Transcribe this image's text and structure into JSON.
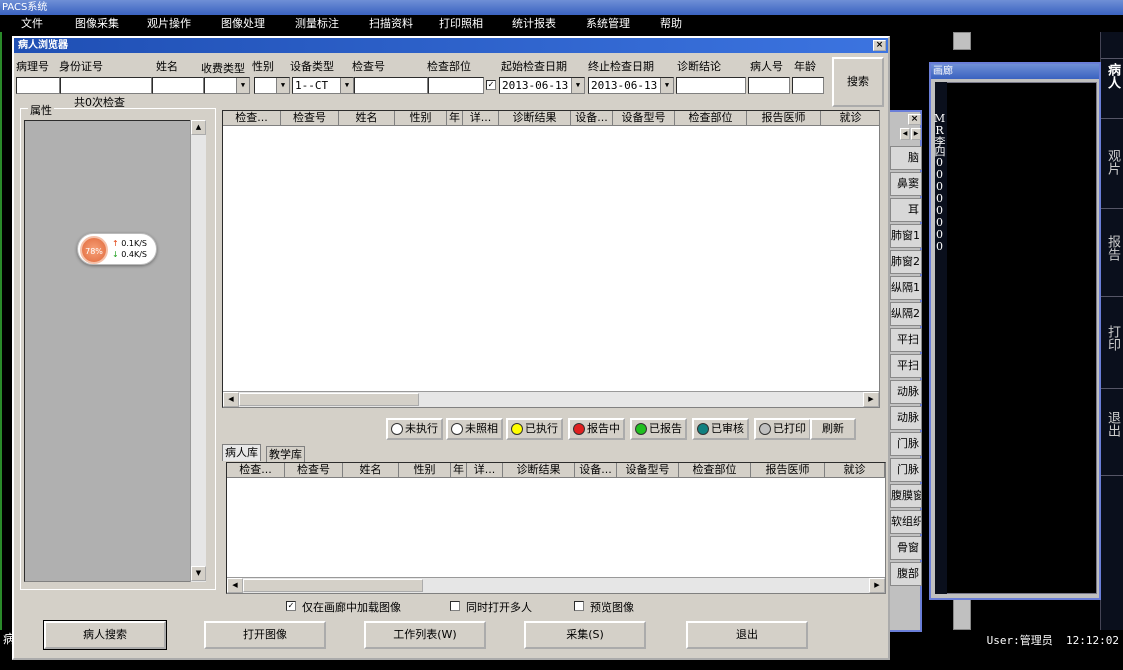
{
  "app": {
    "title": "PACS系统"
  },
  "menu": [
    "文件",
    "图像采集",
    "观片操作",
    "图像处理",
    "测量标注",
    "扫描资料",
    "打印照相",
    "统计报表",
    "系统管理",
    "帮助"
  ],
  "right_bar": {
    "buttons": [
      "病人",
      "观片",
      "报告",
      "打印",
      "退出"
    ]
  },
  "gallery": {
    "title": "画廊",
    "vertical_text": "MR李四00000000"
  },
  "body_parts": [
    "脑",
    "鼻窦",
    "耳",
    "肺窗1",
    "肺窗2",
    "纵隔1",
    "纵隔2",
    "平扫",
    "平扫",
    "动脉",
    "动脉",
    "门脉",
    "门脉",
    "腹膜窗",
    "软组织",
    "骨窗",
    "腹部"
  ],
  "window": {
    "title": "病人浏览器",
    "close_glyph": "×"
  },
  "search": {
    "labels": {
      "patho_no": "病理号",
      "id_card": "身份证号",
      "name": "姓名",
      "fee_type": "收费类型",
      "sex": "性别",
      "device_type": "设备类型",
      "exam_no": "检查号",
      "exam_part": "检查部位",
      "start_date": "起始检查日期",
      "end_date": "终止检查日期",
      "diagnosis": "诊断结论",
      "patient_no": "病人号",
      "age": "年龄"
    },
    "values": {
      "device_type": "1--CT",
      "start_date": "2013-06-13",
      "end_date": "2013-06-13"
    },
    "date_checkbox_checked": true,
    "search_button": "搜索"
  },
  "count_text": "共0次检查",
  "attr_group_label": "属性",
  "net_widget": {
    "percent": "78%",
    "up": "0.1K/S",
    "down": "0.4K/S"
  },
  "grid_top": {
    "columns": [
      "检查...",
      "检查号",
      "姓名",
      "性别",
      "年",
      "详...",
      "诊断结果",
      "设备...",
      "设备型号",
      "检查部位",
      "报告医师",
      "就诊"
    ]
  },
  "status_buttons": [
    {
      "label": "未执行",
      "color": "#ffffff"
    },
    {
      "label": "未照相",
      "color": "#ffffff"
    },
    {
      "label": "已执行",
      "color": "#ffff00"
    },
    {
      "label": "报告中",
      "color": "#e02020"
    },
    {
      "label": "已报告",
      "color": "#20c020"
    },
    {
      "label": "已审核",
      "color": "#108080"
    },
    {
      "label": "已打印",
      "color": "#c0c0c0"
    }
  ],
  "refresh_button": "刷新",
  "tabs": [
    "病人库",
    "教学库"
  ],
  "grid_bottom": {
    "columns": [
      "检查...",
      "检查号",
      "姓名",
      "性别",
      "年",
      "详...",
      "诊断结果",
      "设备...",
      "设备型号",
      "检查部位",
      "报告医师",
      "就诊"
    ]
  },
  "options": [
    {
      "label": "仅在画廊中加载图像",
      "checked": true
    },
    {
      "label": "同时打开多人",
      "checked": false
    },
    {
      "label": "预览图像",
      "checked": false
    }
  ],
  "bottom_buttons": [
    "病人搜索",
    "打开图像",
    "工作列表(W)",
    "采集(S)",
    "退出"
  ],
  "status": {
    "left_char": "病",
    "user": "User:管理员",
    "time": "12:12:02"
  }
}
